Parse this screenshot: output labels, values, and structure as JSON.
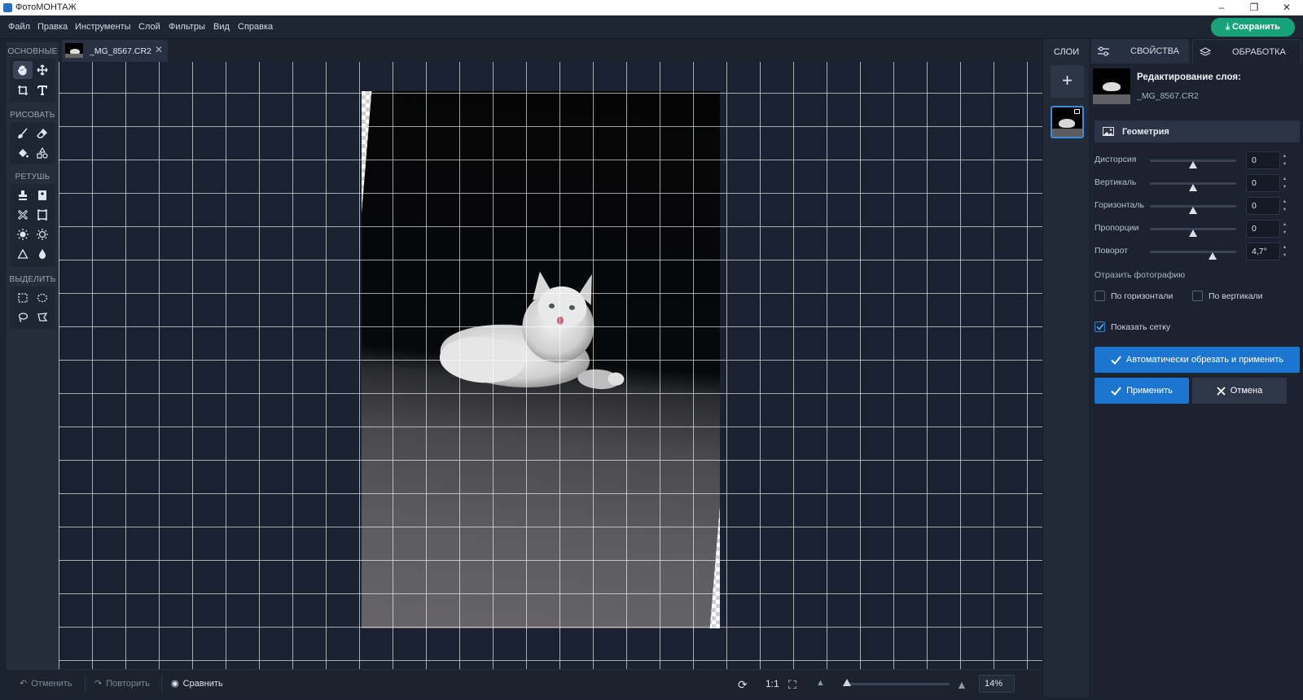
{
  "app": {
    "title": "ФотоМОНТАЖ"
  },
  "window": {
    "minimize": "–",
    "restore": "❐",
    "close": "✕"
  },
  "menu": {
    "items": [
      "Файл",
      "Правка",
      "Инструменты",
      "Слой",
      "Фильтры",
      "Вид",
      "Справка"
    ],
    "save_label": "Сохранить"
  },
  "toolbar": {
    "sections": [
      "ОСНОВНЫЕ",
      "РИСОВАТЬ",
      "РЕТУШЬ",
      "ВЫДЕЛИТЬ"
    ]
  },
  "document": {
    "tab_name": "_MG_8567.CR2",
    "close": "✕",
    "rotation_deg": 4.7
  },
  "status": {
    "undo": "Отменить",
    "redo": "Повторить",
    "compare": "Сравнить",
    "one_to_one": "1:1",
    "zoom": "14%"
  },
  "layers": {
    "title": "СЛОИ",
    "add": "+"
  },
  "panel": {
    "tab_properties": "СВОЙСТВА",
    "tab_processing": "ОБРАБОТКА",
    "edit_title": "Редактирование слоя:",
    "edit_file": "_MG_8567.CR2",
    "geometry_title": "Геометрия",
    "sliders": [
      {
        "label": "Дисторсия",
        "value": "0",
        "pos": 0.5
      },
      {
        "label": "Вертикаль",
        "value": "0",
        "pos": 0.5
      },
      {
        "label": "Горизонталь",
        "value": "0",
        "pos": 0.5
      },
      {
        "label": "Пропорции",
        "value": "0",
        "pos": 0.5
      },
      {
        "label": "Поворот",
        "value": "4,7°",
        "pos": 0.73
      }
    ],
    "mirror_label": "Отразить фотографию",
    "mirror_h": "По горизонтали",
    "mirror_v": "По вертикали",
    "show_grid": "Показать сетку",
    "show_grid_checked": true,
    "auto_crop": "Автоматически обрезать и применить",
    "apply": "Применить",
    "cancel": "Отмена"
  },
  "colors": {
    "accent": "#1c76cf",
    "save": "#18a27a",
    "bg": "#1b2230"
  }
}
